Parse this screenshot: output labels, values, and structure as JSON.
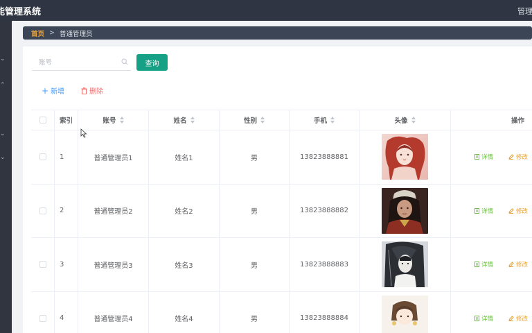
{
  "app": {
    "title": "能管理系统",
    "user_label": "管理"
  },
  "breadcrumb": {
    "home": "首页",
    "separator": ">",
    "current": "普通管理员"
  },
  "search": {
    "placeholder": "账号",
    "value": "",
    "button_label": "查询"
  },
  "toolbar": {
    "add_label": "新增",
    "delete_label": "删除",
    "add_icon": "plus-icon",
    "delete_icon": "trash-icon"
  },
  "colors": {
    "topbar": "#2f3542",
    "accent_green": "#16a085",
    "link_blue": "#409eff",
    "danger_red": "#f56c6c",
    "breadcrumb_home": "#e6a23c",
    "detail_green": "#67c23a",
    "edit_orange": "#e6a23c"
  },
  "table": {
    "columns": [
      "索引",
      "账号",
      "姓名",
      "性别",
      "手机",
      "头像",
      "操作"
    ],
    "rows": [
      {
        "index": "1",
        "account": "普通管理员1",
        "name": "姓名1",
        "sex": "男",
        "phone": "13823888881",
        "detail": "详情",
        "edit": "修改"
      },
      {
        "index": "2",
        "account": "普通管理员2",
        "name": "姓名2",
        "sex": "男",
        "phone": "13823888882",
        "detail": "详情",
        "edit": "修改"
      },
      {
        "index": "3",
        "account": "普通管理员3",
        "name": "姓名3",
        "sex": "男",
        "phone": "13823888883",
        "detail": "详情",
        "edit": "修改"
      },
      {
        "index": "4",
        "account": "普通管理员4",
        "name": "姓名4",
        "sex": "男",
        "phone": "13823888884",
        "detail": "详情",
        "edit": "修改"
      }
    ]
  }
}
